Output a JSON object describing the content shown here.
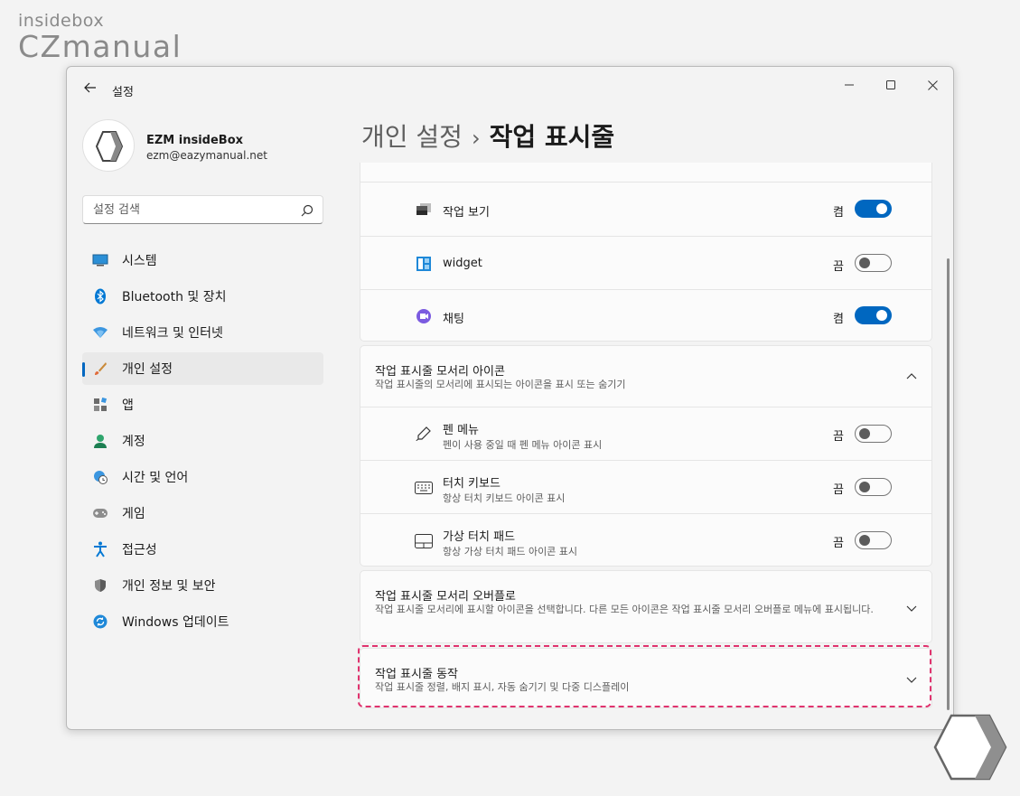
{
  "watermark": {
    "line1": "insidebox",
    "line2": "CZmanual"
  },
  "window": {
    "title": "설정"
  },
  "profile": {
    "name": "EZM insideBox",
    "email": "ezm@eazymanual.net"
  },
  "search": {
    "placeholder": "설정 검색"
  },
  "nav": {
    "items": [
      {
        "label": "시스템",
        "icon": "monitor-icon"
      },
      {
        "label": "Bluetooth 및 장치",
        "icon": "bluetooth-icon"
      },
      {
        "label": "네트워크 및 인터넷",
        "icon": "wifi-icon"
      },
      {
        "label": "개인 설정",
        "icon": "brush-icon",
        "active": true
      },
      {
        "label": "앱",
        "icon": "apps-icon"
      },
      {
        "label": "계정",
        "icon": "person-icon"
      },
      {
        "label": "시간 및 언어",
        "icon": "globe-clock-icon"
      },
      {
        "label": "게임",
        "icon": "gamepad-icon"
      },
      {
        "label": "접근성",
        "icon": "accessibility-icon"
      },
      {
        "label": "개인 정보 및 보안",
        "icon": "shield-icon"
      },
      {
        "label": "Windows 업데이트",
        "icon": "update-icon"
      }
    ]
  },
  "breadcrumb": {
    "parent": "개인 설정",
    "separator": "›",
    "current": "작업 표시줄"
  },
  "taskbar_items": {
    "rows": [
      {
        "label": "작업 보기",
        "state": "켬",
        "on": true,
        "icon": "task-view-icon"
      },
      {
        "label": "widget",
        "state": "끔",
        "on": false,
        "icon": "widgets-icon"
      },
      {
        "label": "채팅",
        "state": "켬",
        "on": true,
        "icon": "chat-icon"
      }
    ]
  },
  "corner_icons": {
    "title": "작업 표시줄 모서리 아이콘",
    "subtitle": "작업 표시줄의 모서리에 표시되는 아이콘을 표시 또는 숨기기",
    "rows": [
      {
        "label": "펜 메뉴",
        "sub": "펜이 사용 중일 때 펜 메뉴 아이콘 표시",
        "state": "끔",
        "on": false,
        "icon": "pen-icon"
      },
      {
        "label": "터치 키보드",
        "sub": "항상 터치 키보드 아이콘 표시",
        "state": "끔",
        "on": false,
        "icon": "keyboard-icon"
      },
      {
        "label": "가상 터치 패드",
        "sub": "항상 가상 터치 패드 아이콘 표시",
        "state": "끔",
        "on": false,
        "icon": "touchpad-icon"
      }
    ]
  },
  "corner_overflow": {
    "title": "작업 표시줄 모서리 오버플로",
    "subtitle": "작업 표시줄 모서리에 표시할 아이콘을 선택합니다. 다른 모든 아이콘은 작업 표시줄 모서리 오버플로 메뉴에 표시됩니다."
  },
  "behaviors": {
    "title": "작업 표시줄 동작",
    "subtitle": "작업 표시줄 정렬, 배지 표시, 자동 숨기기 및 다중 디스플레이"
  },
  "colors": {
    "accent": "#0067c0",
    "highlight": "#e0336e"
  }
}
